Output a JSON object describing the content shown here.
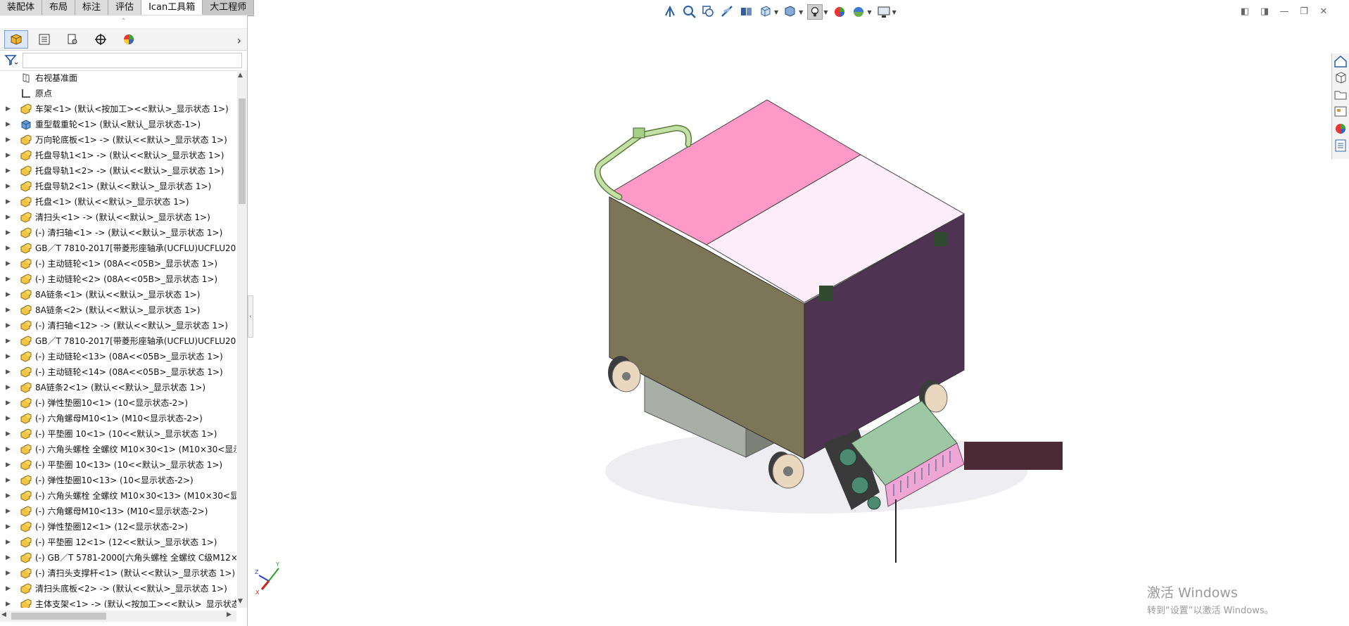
{
  "tabs": [
    {
      "label": "装配体",
      "active": false
    },
    {
      "label": "布局",
      "active": false
    },
    {
      "label": "标注",
      "active": false
    },
    {
      "label": "评估",
      "active": false
    },
    {
      "label": "Ican工具箱",
      "active": true
    },
    {
      "label": "大工程师",
      "active": false
    }
  ],
  "panel": {
    "grip": "⌃",
    "tab_icons": [
      "feature-manager-icon",
      "property-manager-icon",
      "configuration-manager-icon",
      "dimxpert-icon",
      "display-manager-icon"
    ],
    "more": "›",
    "filter_icon": "filter-icon"
  },
  "tree": [
    {
      "label": "右视基准面",
      "kind": "plane",
      "expand": false
    },
    {
      "label": "原点",
      "kind": "origin",
      "expand": false
    },
    {
      "label": "车架<1> (默认<按加工><<默认>_显示状态 1>)",
      "kind": "asm",
      "expand": true
    },
    {
      "label": "重型载重轮<1> (默认<默认_显示状态-1>)",
      "kind": "part",
      "expand": true
    },
    {
      "label": "万向轮底板<1> -> (默认<<默认>_显示状态 1>)",
      "kind": "asm",
      "expand": true
    },
    {
      "label": "托盘导轨1<1> -> (默认<<默认>_显示状态 1>)",
      "kind": "asm",
      "expand": true
    },
    {
      "label": "托盘导轨1<2> -> (默认<<默认>_显示状态 1>)",
      "kind": "asm",
      "expand": true
    },
    {
      "label": "托盘导轨2<1> (默认<<默认>_显示状态 1>)",
      "kind": "asm",
      "expand": true
    },
    {
      "label": "托盘<1> (默认<<默认>_显示状态 1>)",
      "kind": "asm",
      "expand": true
    },
    {
      "label": "清扫头<1> -> (默认<<默认>_显示状态 1>)",
      "kind": "asm",
      "expand": true
    },
    {
      "label": "(-) 清扫轴<1> -> (默认<<默认>_显示状态 1>)",
      "kind": "asm",
      "expand": true
    },
    {
      "label": "GB／T 7810-2017[带菱形座轴承(UCFLU)UCFLU202]-",
      "kind": "asm",
      "expand": true
    },
    {
      "label": "(-) 主动链轮<1> (08A<<05B>_显示状态 1>)",
      "kind": "asm",
      "expand": true
    },
    {
      "label": "(-) 主动链轮<2> (08A<<05B>_显示状态 1>)",
      "kind": "asm",
      "expand": true
    },
    {
      "label": "8A链条<1> (默认<<默认>_显示状态 1>)",
      "kind": "asm",
      "expand": true
    },
    {
      "label": "8A链条<2> (默认<<默认>_显示状态 1>)",
      "kind": "asm",
      "expand": true
    },
    {
      "label": "(-) 清扫轴<12> -> (默认<<默认>_显示状态 1>)",
      "kind": "asm",
      "expand": true
    },
    {
      "label": "GB／T 7810-2017[带菱形座轴承(UCFLU)UCFLU202]-",
      "kind": "asm",
      "expand": true
    },
    {
      "label": "(-) 主动链轮<13> (08A<<05B>_显示状态 1>)",
      "kind": "asm",
      "expand": true
    },
    {
      "label": "(-) 主动链轮<14> (08A<<05B>_显示状态 1>)",
      "kind": "asm",
      "expand": true
    },
    {
      "label": "8A链条2<1> (默认<<默认>_显示状态 1>)",
      "kind": "asm",
      "expand": true
    },
    {
      "label": "(-) 弹性垫圈10<1> (10<显示状态-2>)",
      "kind": "asm",
      "expand": true
    },
    {
      "label": "(-) 六角螺母M10<1> (M10<显示状态-2>)",
      "kind": "asm",
      "expand": true
    },
    {
      "label": "(-) 平垫圈 10<1> (10<<默认>_显示状态 1>)",
      "kind": "asm",
      "expand": true
    },
    {
      "label": "(-) 六角头螺栓 全螺纹 M10×30<1> (M10×30<显示",
      "kind": "asm",
      "expand": true
    },
    {
      "label": "(-) 平垫圈 10<13> (10<<默认>_显示状态 1>)",
      "kind": "asm",
      "expand": true
    },
    {
      "label": "(-) 弹性垫圈10<13> (10<显示状态-2>)",
      "kind": "asm",
      "expand": true
    },
    {
      "label": "(-) 六角头螺栓 全螺纹 M10×30<13> (M10×30<显示",
      "kind": "asm",
      "expand": true
    },
    {
      "label": "(-) 六角螺母M10<13> (M10<显示状态-2>)",
      "kind": "asm",
      "expand": true
    },
    {
      "label": "(-) 弹性垫圈12<1> (12<显示状态-2>)",
      "kind": "asm",
      "expand": true
    },
    {
      "label": "(-) 平垫圈 12<1> (12<<默认>_显示状态 1>)",
      "kind": "asm",
      "expand": true
    },
    {
      "label": "(-) GB／T 5781-2000[六角头螺栓 全螺纹 C级M12×3",
      "kind": "asm",
      "expand": true
    },
    {
      "label": "(-) 清扫头支撑杆<1> (默认<<默认>_显示状态 1>)",
      "kind": "asm",
      "expand": true
    },
    {
      "label": "清扫头底板<2> -> (默认<<默认>_显示状态 1>)",
      "kind": "asm",
      "expand": true
    },
    {
      "label": "主体支架<1> -> (默认<按加工><<默认>_显示状态",
      "kind": "asm",
      "expand": true
    }
  ],
  "hud": [
    {
      "icon": "zoom-to-fit-icon"
    },
    {
      "icon": "zoom-to-area-icon"
    },
    {
      "icon": "previous-view-icon"
    },
    {
      "icon": "section-view-icon"
    },
    {
      "icon": "dynamic-annotation-icon"
    },
    {
      "icon": "view-orientation-icon",
      "caret": true
    },
    {
      "icon": "display-style-icon",
      "caret": true
    },
    {
      "icon": "hide-show-items-icon",
      "caret": true,
      "active": true
    },
    {
      "icon": "edit-appearance-icon"
    },
    {
      "icon": "apply-scene-icon",
      "caret": true
    },
    {
      "icon": "view-settings-icon",
      "caret": true
    }
  ],
  "window_controls": [
    "tile-left-icon",
    "tile-right-icon",
    "minimize-icon",
    "restore-icon",
    "close-icon"
  ],
  "taskpane": [
    "solidworks-resources-icon",
    "design-library-icon",
    "file-explorer-icon",
    "view-palette-icon",
    "appearances-icon",
    "custom-properties-icon"
  ],
  "colors": {
    "lid_left": "#ff99c8",
    "lid_right": "#fdeefa",
    "body_front": "#7d7557",
    "body_side": "#4f3353",
    "handle": "#c4e0a4",
    "brush_panel": "#9ec7a6",
    "block": "#4c2a35"
  },
  "triad": {
    "x": "X",
    "y": "Y",
    "z": "Z"
  },
  "watermark": {
    "line1": "激活 Windows",
    "line2": "转到“设置”以激活 Windows。"
  }
}
